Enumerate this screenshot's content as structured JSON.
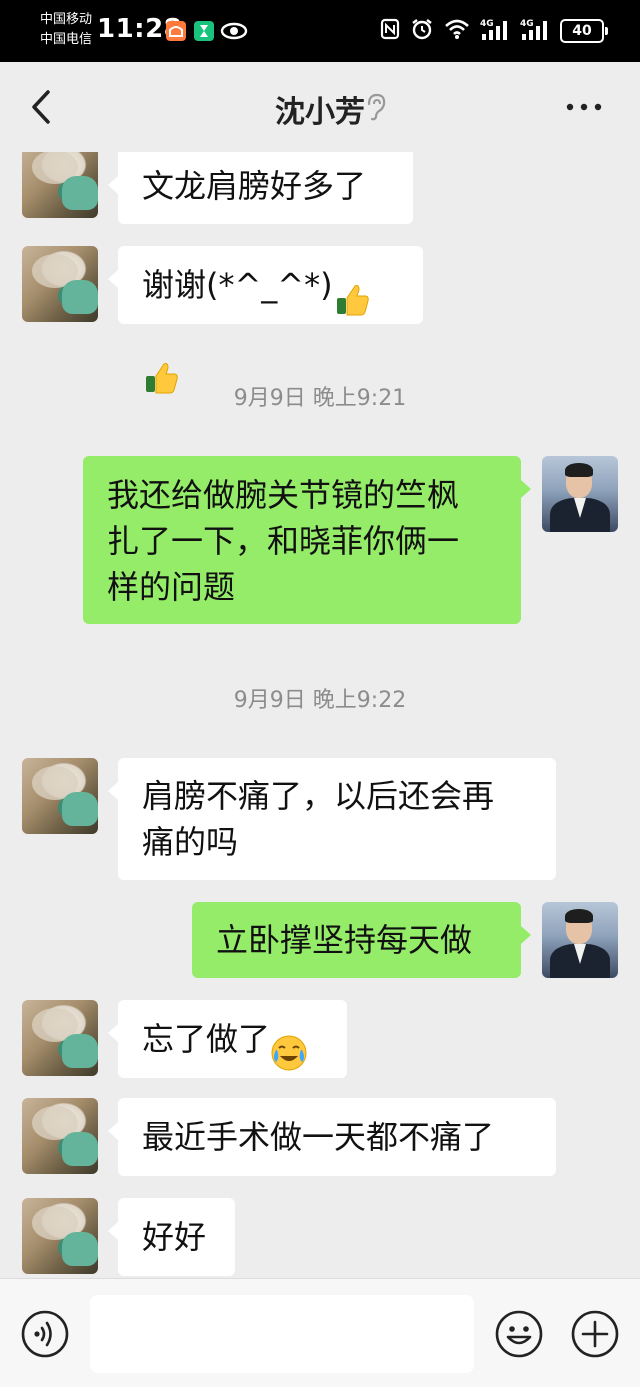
{
  "status_bar": {
    "carrier_1": "中国移动",
    "carrier_2": "中国电信",
    "time": "11:28",
    "battery": "40"
  },
  "header": {
    "title": "沈小芳"
  },
  "messages": [
    {
      "side": "left",
      "text": "文龙肩膀好多了"
    },
    {
      "side": "left",
      "text": "谢谢(*^_^*)"
    },
    {
      "side": "time",
      "text": "9月9日 晚上9:21"
    },
    {
      "side": "right",
      "line_1": "我还给做腕关节镜的竺枫",
      "line_2": "扎了一下，和晓菲你俩一",
      "line_3": "样的问题"
    },
    {
      "side": "time",
      "text": "9月9日 晚上9:22"
    },
    {
      "side": "left",
      "line_1": "肩膀不痛了，以后还会再",
      "line_2": "痛的吗"
    },
    {
      "side": "right",
      "text": "立卧撑坚持每天做"
    },
    {
      "side": "left",
      "text": "忘了做了"
    },
    {
      "side": "left",
      "text": "最近手术做一天都不痛了"
    },
    {
      "side": "left",
      "text": "好好"
    }
  ],
  "input": {
    "value": ""
  },
  "icons": {
    "back": "chevron-left-icon",
    "ear": "ear-icon",
    "more": "more-dots-icon",
    "voice": "voice-icon",
    "emoji": "smiley-icon",
    "plus": "plus-icon",
    "thumbs_up": "thumbs-up-emoji",
    "crying": "crying-laughing-emoji"
  },
  "colors": {
    "background": "#ededed",
    "bubble_self": "#95ec69",
    "bubble_other": "#ffffff",
    "timestamp": "#8c8c8c"
  }
}
